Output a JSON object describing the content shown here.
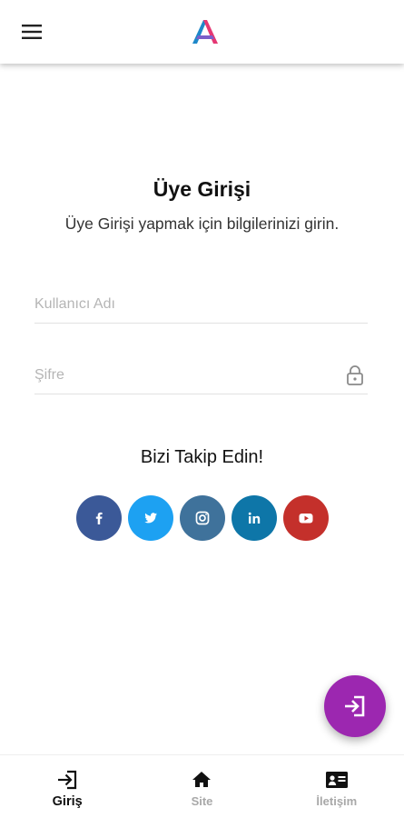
{
  "header": {
    "menu_icon": "menu-icon",
    "logo": "brand-logo",
    "logo_colors": {
      "left": "#1e88c9",
      "right": "#e53773"
    }
  },
  "login": {
    "title": "Üye Girişi",
    "subtitle": "Üye Girişi yapmak için bilgilerinizi girin.",
    "username": {
      "placeholder": "Kullanıcı Adı",
      "value": ""
    },
    "password": {
      "placeholder": "Şifre",
      "value": "",
      "icon": "lock-icon"
    }
  },
  "social": {
    "title": "Bizi Takip Edin!",
    "items": [
      {
        "name": "facebook",
        "icon": "facebook-icon",
        "color": "#3b5998"
      },
      {
        "name": "twitter",
        "icon": "twitter-icon",
        "color": "#1da1f2"
      },
      {
        "name": "instagram",
        "icon": "instagram-icon",
        "color": "#3f729b"
      },
      {
        "name": "linkedin",
        "icon": "linkedin-icon",
        "color": "#0e76a8"
      },
      {
        "name": "youtube",
        "icon": "youtube-icon",
        "color": "#c4302b"
      }
    ]
  },
  "fab": {
    "icon": "login-icon",
    "color": "#9c27b0"
  },
  "bottom_nav": {
    "items": [
      {
        "label": "Giriş",
        "icon": "login-icon",
        "active": true
      },
      {
        "label": "Site",
        "icon": "home-icon",
        "active": false
      },
      {
        "label": "İletişim",
        "icon": "contact-card-icon",
        "active": false
      }
    ]
  }
}
